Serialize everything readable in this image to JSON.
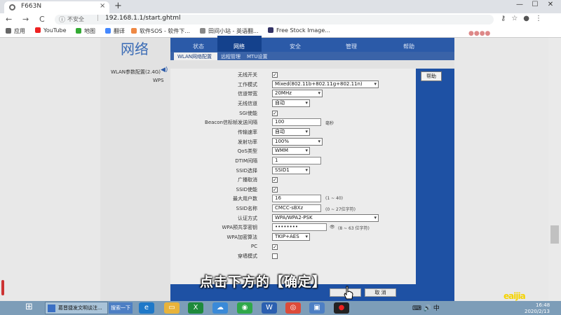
{
  "browser": {
    "tab_title": "F663N",
    "tab_close": "×",
    "new_tab": "+",
    "win_controls": [
      "—",
      "☐",
      "✕"
    ],
    "nav": {
      "back": "←",
      "forward": "→",
      "reload": "C"
    },
    "security_text": "不安全",
    "url": "192.168.1.1/start.ghtml",
    "bookmarks": [
      "应用",
      "YouTube",
      "地图",
      "翻译",
      "软件SOS - 软件下...",
      "田间小站 - 英语翻...",
      "Free Stock Image..."
    ]
  },
  "router": {
    "section_title": "网络",
    "top_nav": [
      "状态",
      "网络",
      "安全",
      "管理",
      "帮助"
    ],
    "sub_nav": [
      "WLAN网络配置",
      "远程管理",
      "MTU设置"
    ],
    "left_menu": [
      "WLAN参数配置(2.4G)",
      "WPS"
    ],
    "help_button": "帮助",
    "fields": [
      {
        "label": "无线开关",
        "type": "checkbox",
        "value": "✓"
      },
      {
        "label": "工作模式",
        "type": "select",
        "value": "Mixed(802.11b+802.11g+802.11n)"
      },
      {
        "label": "信道带宽",
        "type": "select",
        "value": "20MHz"
      },
      {
        "label": "无线信道",
        "type": "select",
        "value": "自动"
      },
      {
        "label": "SGI使能",
        "type": "checkbox",
        "value": "✓"
      },
      {
        "label": "Beacon信标帧发送间隔",
        "type": "input",
        "value": "100",
        "hint": "毫秒"
      },
      {
        "label": "传输速率",
        "type": "select",
        "value": "自动"
      },
      {
        "label": "发射功率",
        "type": "select",
        "value": "100%"
      },
      {
        "label": "QoS类型",
        "type": "select",
        "value": "WMM"
      },
      {
        "label": "DTIM间隔",
        "type": "input",
        "value": "1"
      },
      {
        "label": "SSID选择",
        "type": "select",
        "value": "SSID1"
      },
      {
        "label": "广播取消",
        "type": "checkbox",
        "value": "✓"
      },
      {
        "label": "SSID使能",
        "type": "checkbox",
        "value": "✓"
      },
      {
        "label": "最大用户数",
        "type": "input",
        "value": "16",
        "hint": "(1 ~ 40)"
      },
      {
        "label": "SSID名称",
        "type": "input",
        "value": "CMCC-sBXz",
        "hint": "(0 ~ 27位字符)"
      },
      {
        "label": "认证方式",
        "type": "select",
        "value": "WPA/WPA2-PSK"
      },
      {
        "label": "WPA预共享密钥",
        "type": "input",
        "value": "••••••••",
        "hint": "(8 ~ 63 位字符)"
      },
      {
        "label": "WPA加密算法",
        "type": "select",
        "value": "TKIP+AES"
      },
      {
        "label": "PC",
        "type": "checkbox",
        "value": "✓"
      },
      {
        "label": "穿墙模式",
        "type": "checkbox",
        "value": ""
      }
    ],
    "cancel_button": "取 消"
  },
  "subtitle": "点击下方的【确定】",
  "taskbar": {
    "task1": "葛晋捷发文明谈注...",
    "search": "搜索一下",
    "time": "16:48",
    "date": "2020/2/13",
    "tray": "⌨ 🔊 中"
  },
  "watermark": "eaijia"
}
